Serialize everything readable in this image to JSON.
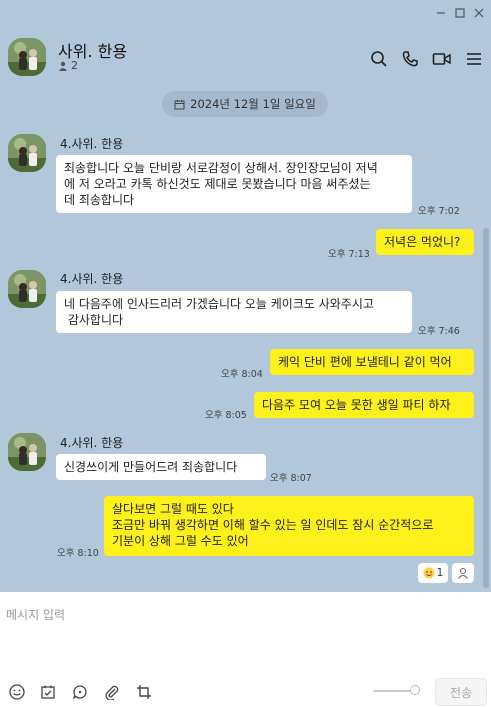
{
  "window": {
    "min_icon": "minimize-icon",
    "max_icon": "maximize-icon",
    "close_icon": "close-icon"
  },
  "header": {
    "title": "사위. 한용",
    "member_count": "2",
    "icons": [
      "search-icon",
      "phone-icon",
      "video-call-icon",
      "menu-icon"
    ]
  },
  "date_divider": "2024년 12월 1일 일요일",
  "messages": [
    {
      "sender": "4.사위. 한용",
      "text": "죄송합니다 오늘 단비랑 서로감정이 상해서. 장인장모님이 저녁\n에 저 오라고 카톡 하신것도 제대로 못봤습니다 마음 써주셨는\n데 죄송합니다",
      "time": "오후 7:02",
      "mine": false
    },
    {
      "text": "저녁은 먹었니?",
      "time": "오후 7:13",
      "mine": true
    },
    {
      "sender": "4.사위. 한용",
      "text": "네 다음주에 인사드리러 가겠습니다 오늘 케이크도 사와주시고\n 감사합니다",
      "time": "오후 7:46",
      "mine": false
    },
    {
      "text": "케익 단비 편에 보낼테니 같이 먹어",
      "time": "오후 8:04",
      "mine": true
    },
    {
      "text": "다음주 모여 오늘 못한 생일 파티 하자",
      "time": "오후 8:05",
      "mine": true
    },
    {
      "sender": "4.사위. 한용",
      "text": "신경쓰이게 만들어드려 죄송합니다",
      "time": "오후 8:07",
      "mine": false
    },
    {
      "text": "살다보면 그럴 때도 있다\n조금만 바꿔 생각하면 이해 할수 있는 일 인데도 잠시 순간적으로\n기분이 상해 그럴 수도 있어",
      "time": "오후 8:10",
      "mine": true
    }
  ],
  "reaction": {
    "count": "1",
    "emoji_icon": "smile-reaction-icon",
    "user_icon": "person-icon"
  },
  "composer": {
    "placeholder": "메시지 입력",
    "send_label": "전송",
    "tools": [
      "emoji-icon",
      "calendar-check-icon",
      "chat-bubble-icon",
      "paperclip-icon",
      "crop-icon"
    ]
  },
  "colors": {
    "background": "#b2c7da",
    "my_bubble": "#fef01b",
    "their_bubble": "#ffffff"
  }
}
